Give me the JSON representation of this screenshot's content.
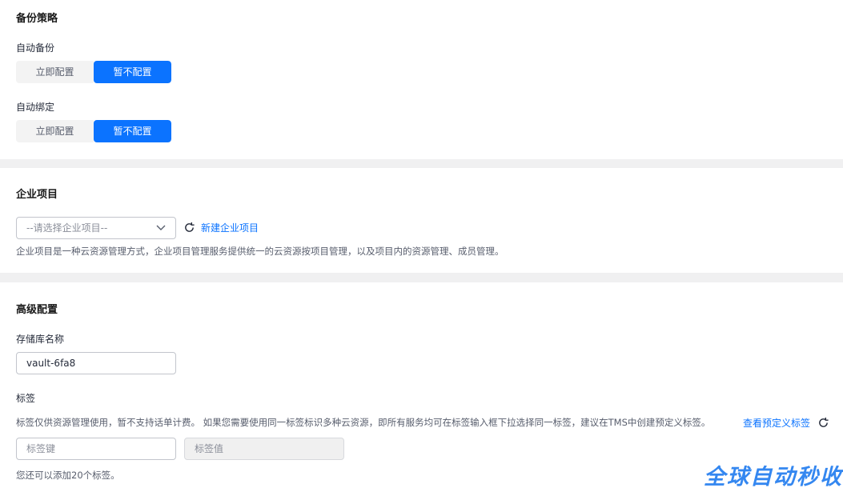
{
  "backup_policy": {
    "title": "备份策略",
    "auto_backup": {
      "label": "自动备份",
      "options": [
        "立即配置",
        "暂不配置"
      ],
      "selected": "暂不配置"
    },
    "auto_bind": {
      "label": "自动绑定",
      "options": [
        "立即配置",
        "暂不配置"
      ],
      "selected": "暂不配置"
    }
  },
  "enterprise_project": {
    "title": "企业项目",
    "select_placeholder": "--请选择企业项目--",
    "create_link": "新建企业项目",
    "description": "企业项目是一种云资源管理方式，企业项目管理服务提供统一的云资源按项目管理，以及项目内的资源管理、成员管理。"
  },
  "advanced": {
    "title": "高级配置",
    "vault_name": {
      "label": "存储库名称",
      "value": "vault-6fa8"
    },
    "tags": {
      "label": "标签",
      "description": "标签仅供资源管理使用，暂不支持话单计费。 如果您需要使用同一标签标识多种云资源，即所有服务均可在标签输入框下拉选择同一标签，建议在TMS中创建预定义标签。",
      "predefined_link": "查看预定义标签",
      "key_placeholder": "标签键",
      "value_placeholder": "标签值",
      "remaining": "您还可以添加20个标签。"
    }
  },
  "watermark": "全球自动秒收",
  "colors": {
    "primary": "#0b73ff",
    "segment_off": "#f3f3f3",
    "page_bg": "#f0f0f1"
  },
  "icons": {
    "chevron": "chevron-down-icon",
    "refresh": "refresh-icon"
  }
}
